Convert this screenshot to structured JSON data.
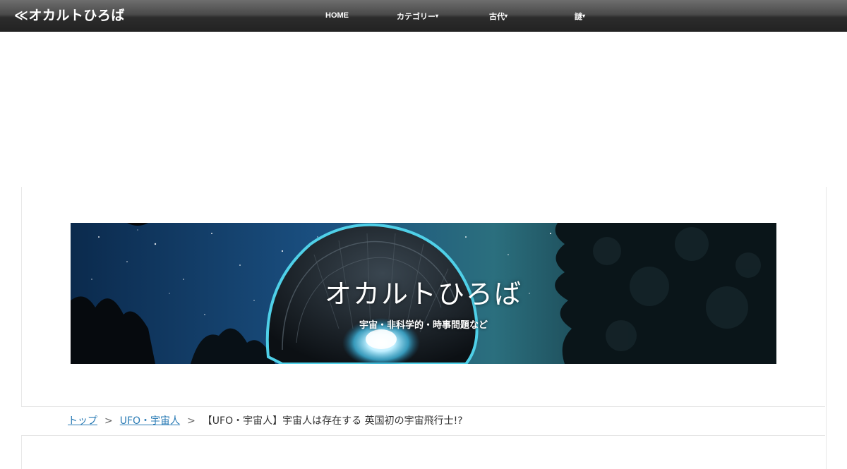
{
  "header": {
    "site_title": "≪オカルトひろば",
    "nav": [
      {
        "label": "HOME",
        "has_dropdown": false
      },
      {
        "label": "カテゴリー",
        "has_dropdown": true
      },
      {
        "label": "古代",
        "has_dropdown": true
      },
      {
        "label": "謎",
        "has_dropdown": true
      }
    ],
    "dropdown_glyph": "▾"
  },
  "hero": {
    "title": "オカルトひろば",
    "subtitle": "宇宙・非科学的・時事問題など"
  },
  "breadcrumb": {
    "items": [
      {
        "label": "トップ",
        "link": true
      },
      {
        "label": "UFO・宇宙人",
        "link": true
      },
      {
        "label": "【UFO・宇宙人】宇宙人は存在する 英国初の宇宙飛行士!?",
        "link": false
      }
    ],
    "separator": ">"
  },
  "colors": {
    "header_bg": "#3a3a3a",
    "link": "#2a7bb5",
    "text": "#333333"
  }
}
